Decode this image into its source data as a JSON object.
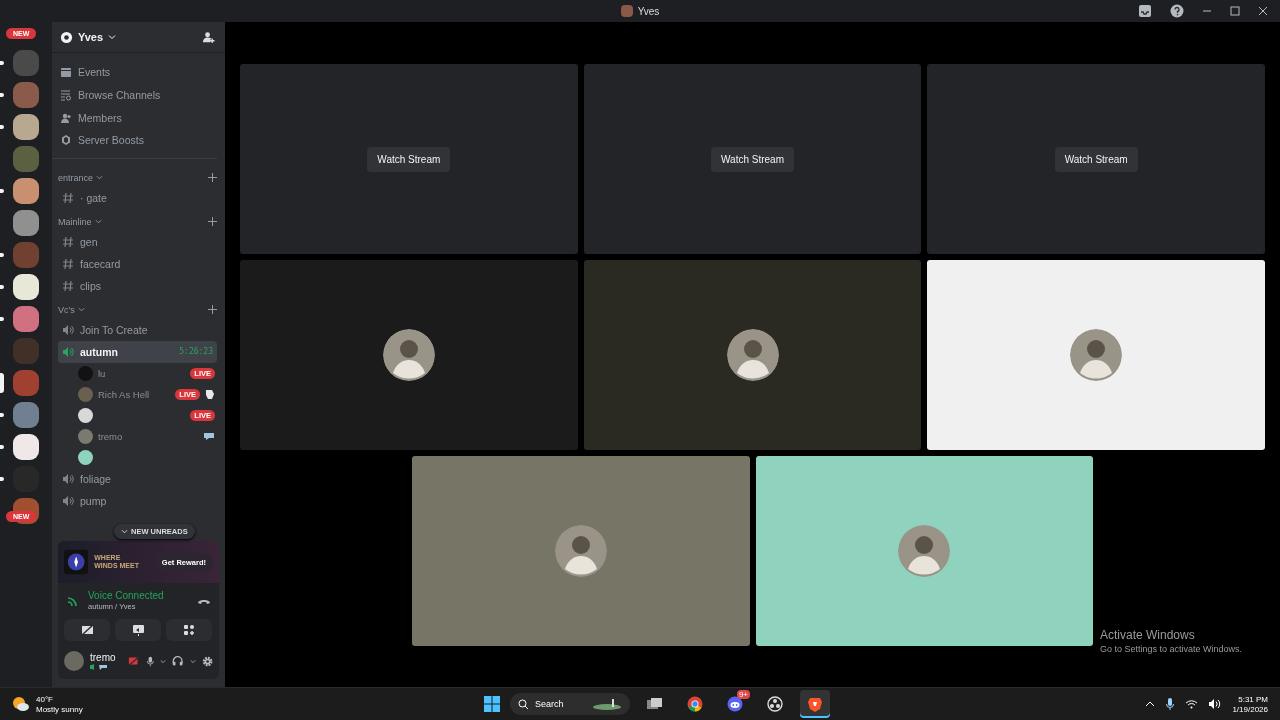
{
  "titlebar": {
    "title": "Yves"
  },
  "servers": [
    {
      "color": "#4a4a4a",
      "unread": true,
      "selected": false
    },
    {
      "color": "#8a5a4a",
      "unread": true,
      "selected": false
    },
    {
      "color": "#b8a890",
      "unread": true,
      "selected": false
    },
    {
      "color": "#5a6040",
      "unread": false,
      "selected": false
    },
    {
      "color": "#c89070",
      "unread": true,
      "selected": false
    },
    {
      "color": "#909090",
      "unread": false,
      "selected": false
    },
    {
      "color": "#704030",
      "unread": true,
      "selected": false
    },
    {
      "color": "#e8e8d8",
      "unread": true,
      "selected": false
    },
    {
      "color": "#d07080",
      "unread": true,
      "selected": false
    },
    {
      "color": "#403028",
      "unread": false,
      "selected": false
    },
    {
      "color": "#a04030",
      "unread": false,
      "selected": true
    },
    {
      "color": "#708090",
      "unread": true,
      "selected": false
    },
    {
      "color": "#f0e8e8",
      "unread": true,
      "selected": false
    },
    {
      "color": "#282828",
      "unread": true,
      "selected": false
    },
    {
      "color": "#a05030",
      "unread": false,
      "selected": false
    }
  ],
  "new_badges": [
    "NEW",
    "NEW"
  ],
  "server": {
    "name": "Yves"
  },
  "menu": [
    {
      "kind": "events",
      "label": "Events"
    },
    {
      "kind": "browse",
      "label": "Browse Channels"
    },
    {
      "kind": "members",
      "label": "Members"
    },
    {
      "kind": "boosts",
      "label": "Server Boosts"
    }
  ],
  "categories": [
    {
      "name": "entrance",
      "channels": [
        {
          "kind": "text",
          "name": "· gate",
          "selected": false
        }
      ]
    },
    {
      "name": "Mainline",
      "channels": [
        {
          "kind": "text",
          "name": "gen",
          "selected": false
        },
        {
          "kind": "text",
          "name": "facecard",
          "selected": false
        },
        {
          "kind": "text",
          "name": "clips",
          "selected": false
        }
      ]
    },
    {
      "name": "Vc's",
      "channels": [
        {
          "kind": "voice",
          "name": "Join To Create",
          "selected": false
        },
        {
          "kind": "voice",
          "name": "autumn",
          "selected": true,
          "timer": "5:26:23",
          "members": [
            {
              "kind": "plain",
              "name": "lu",
              "live": "LIVE",
              "color": "#121212"
            },
            {
              "kind": "activity",
              "name": "Rich As Hell",
              "live": "LIVE",
              "color": "#6a6050"
            },
            {
              "kind": "plain",
              "live": "LIVE",
              "color": "#d8d8d8"
            },
            {
              "kind": "bubble",
              "name": "tremo",
              "color": "#7a7a70"
            },
            {
              "kind": "plain",
              "color": "#8fd3bf"
            }
          ]
        },
        {
          "kind": "voice",
          "name": "foliage",
          "selected": false
        },
        {
          "kind": "voice",
          "name": "pump",
          "selected": false
        }
      ]
    }
  ],
  "unreads_pill": "NEW UNREADS",
  "promo": {
    "logo_text": "WHERE WINDS MEET",
    "button": "Get Reward!"
  },
  "voice": {
    "status": "Voice Connected",
    "location": "autumn / Yves"
  },
  "user": {
    "name": "tremo"
  },
  "tiles": [
    {
      "kind": "stream",
      "button": "Watch Stream"
    },
    {
      "kind": "stream",
      "button": "Watch Stream"
    },
    {
      "kind": "stream",
      "button": "Watch Stream"
    },
    {
      "kind": "camera",
      "color": "#1a1b1a"
    },
    {
      "kind": "camera",
      "color": "#2a2a23"
    },
    {
      "kind": "camera",
      "color": "#f0f0f0"
    },
    {
      "kind": "camera",
      "color": "#777566"
    },
    {
      "kind": "camera",
      "color": "#8fd3bf"
    }
  ],
  "activation": {
    "title": "Activate Windows",
    "hint": "Go to Settings to activate Windows."
  },
  "taskbar": {
    "weather": {
      "temp": "40°F",
      "condition": "Mostly sunny"
    },
    "search": "Search",
    "apps": [
      {
        "kind": "taskview",
        "selected": false
      },
      {
        "kind": "chrome",
        "selected": false
      },
      {
        "kind": "discord",
        "badge": "9+",
        "selected": false
      },
      {
        "kind": "obs",
        "selected": false
      },
      {
        "kind": "brave",
        "selected": true
      }
    ],
    "clock": {
      "time": "5:31 PM",
      "date": "1/19/2026"
    }
  }
}
